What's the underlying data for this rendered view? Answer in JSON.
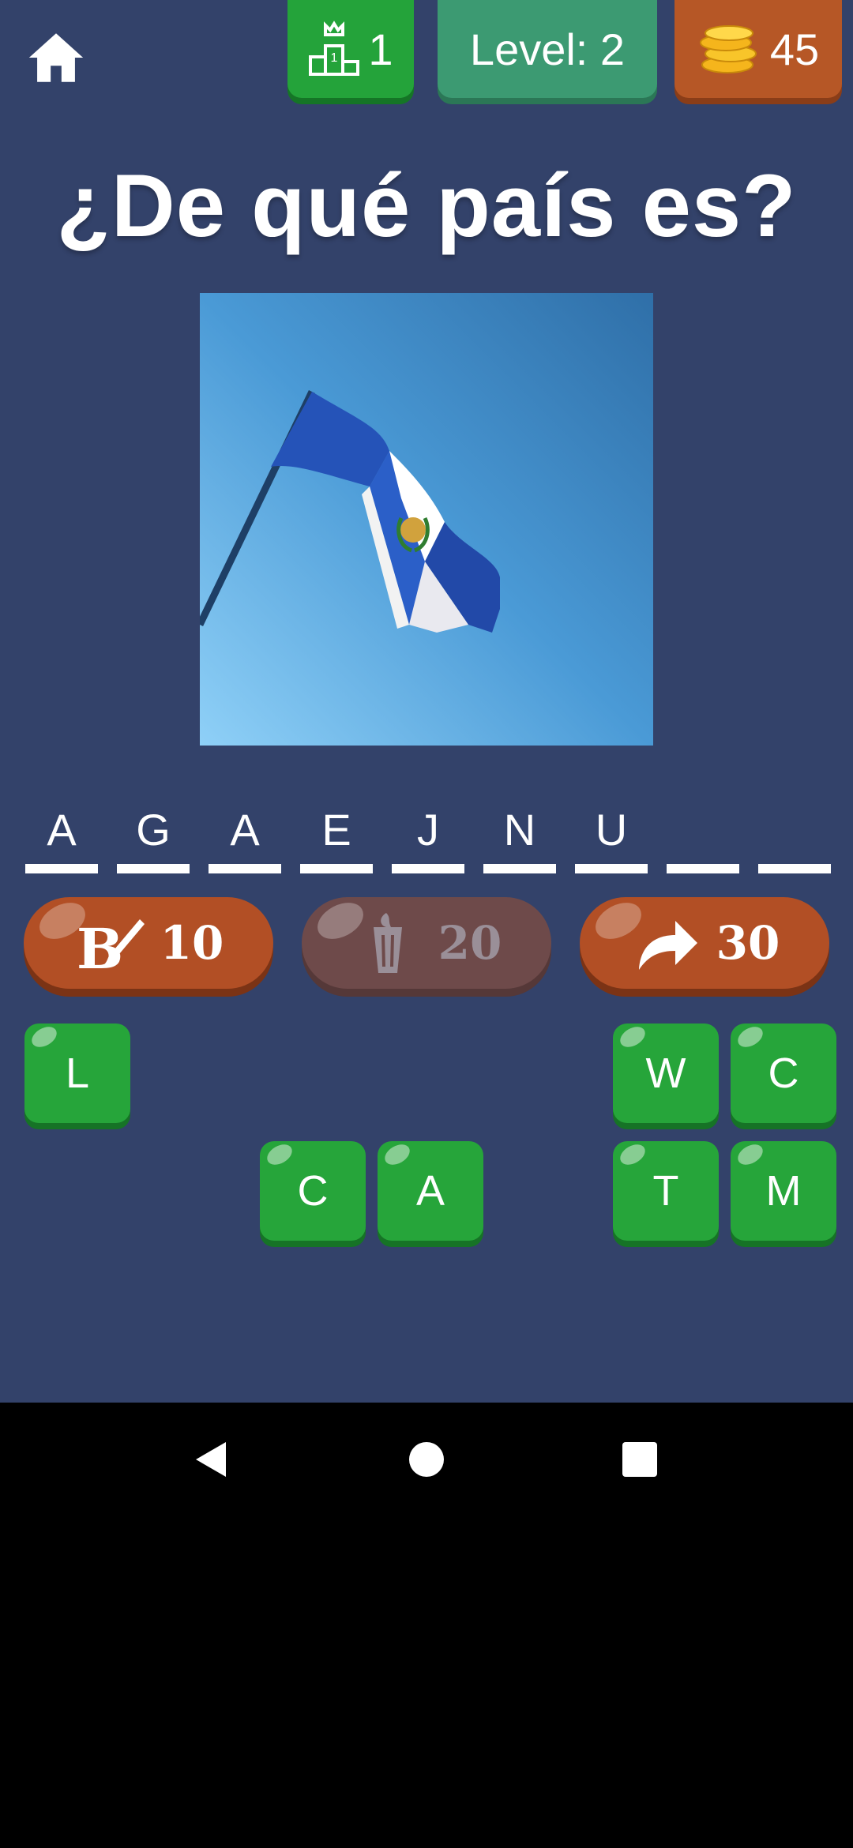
{
  "topbar": {
    "home_icon": "home-icon",
    "rank_value": "1",
    "level_label": "Level: 2",
    "coins_value": "45"
  },
  "question": {
    "title": "¿De qué país es?",
    "image_icon": "guatemala-flag-photo"
  },
  "answer": {
    "slots": [
      "A",
      "G",
      "A",
      "E",
      "J",
      "N",
      "U",
      "",
      ""
    ]
  },
  "hints": [
    {
      "icon": "paint-brush-icon",
      "cost": "10",
      "enabled": true
    },
    {
      "icon": "trash-bin-icon",
      "cost": "20",
      "enabled": false
    },
    {
      "icon": "skip-arrow-icon",
      "cost": "30",
      "enabled": true
    }
  ],
  "tiles": {
    "row1": [
      "L",
      "",
      "",
      "",
      "",
      "W",
      "C"
    ],
    "row2": [
      "",
      "",
      "C",
      "A",
      "",
      "T",
      "M"
    ]
  },
  "colors": {
    "background": "#33426a",
    "tile_green": "#26a53a",
    "hint_brown": "#b24f25",
    "level_teal": "#3c9a72"
  }
}
